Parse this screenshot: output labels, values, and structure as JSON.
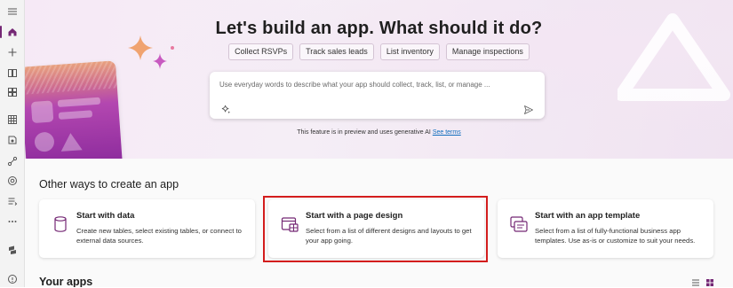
{
  "hero": {
    "title": "Let's build an app. What should it do?",
    "chips": [
      "Collect RSVPs",
      "Track sales leads",
      "List inventory",
      "Manage inspections"
    ],
    "prompt_placeholder": "Use everyday words to describe what your app should collect, track, list, or manage ...",
    "disclaimer": "This feature is in preview and uses generative AI",
    "disclaimer_link": "See terms"
  },
  "other_ways": {
    "title": "Other ways to create an app",
    "cards": [
      {
        "title": "Start with data",
        "desc": "Create new tables, select existing tables, or connect to external data sources."
      },
      {
        "title": "Start with a page design",
        "desc": "Select from a list of different designs and layouts to get your app going."
      },
      {
        "title": "Start with an app template",
        "desc": "Select from a list of fully-functional business app templates. Use as-is or customize to suit your needs."
      }
    ]
  },
  "your_apps": {
    "title": "Your apps"
  },
  "icons": {
    "rail": [
      "hamburger-icon",
      "home-icon",
      "plus-icon",
      "book-icon",
      "apps-icon",
      "table-icon",
      "flow-icon",
      "connector-icon",
      "globe-icon",
      "solutions-icon",
      "more-icon",
      "power-platform-icon",
      "help-icon"
    ]
  },
  "colors": {
    "accent": "#742774",
    "highlight": "#d31d1d",
    "link": "#0f6cbd"
  }
}
